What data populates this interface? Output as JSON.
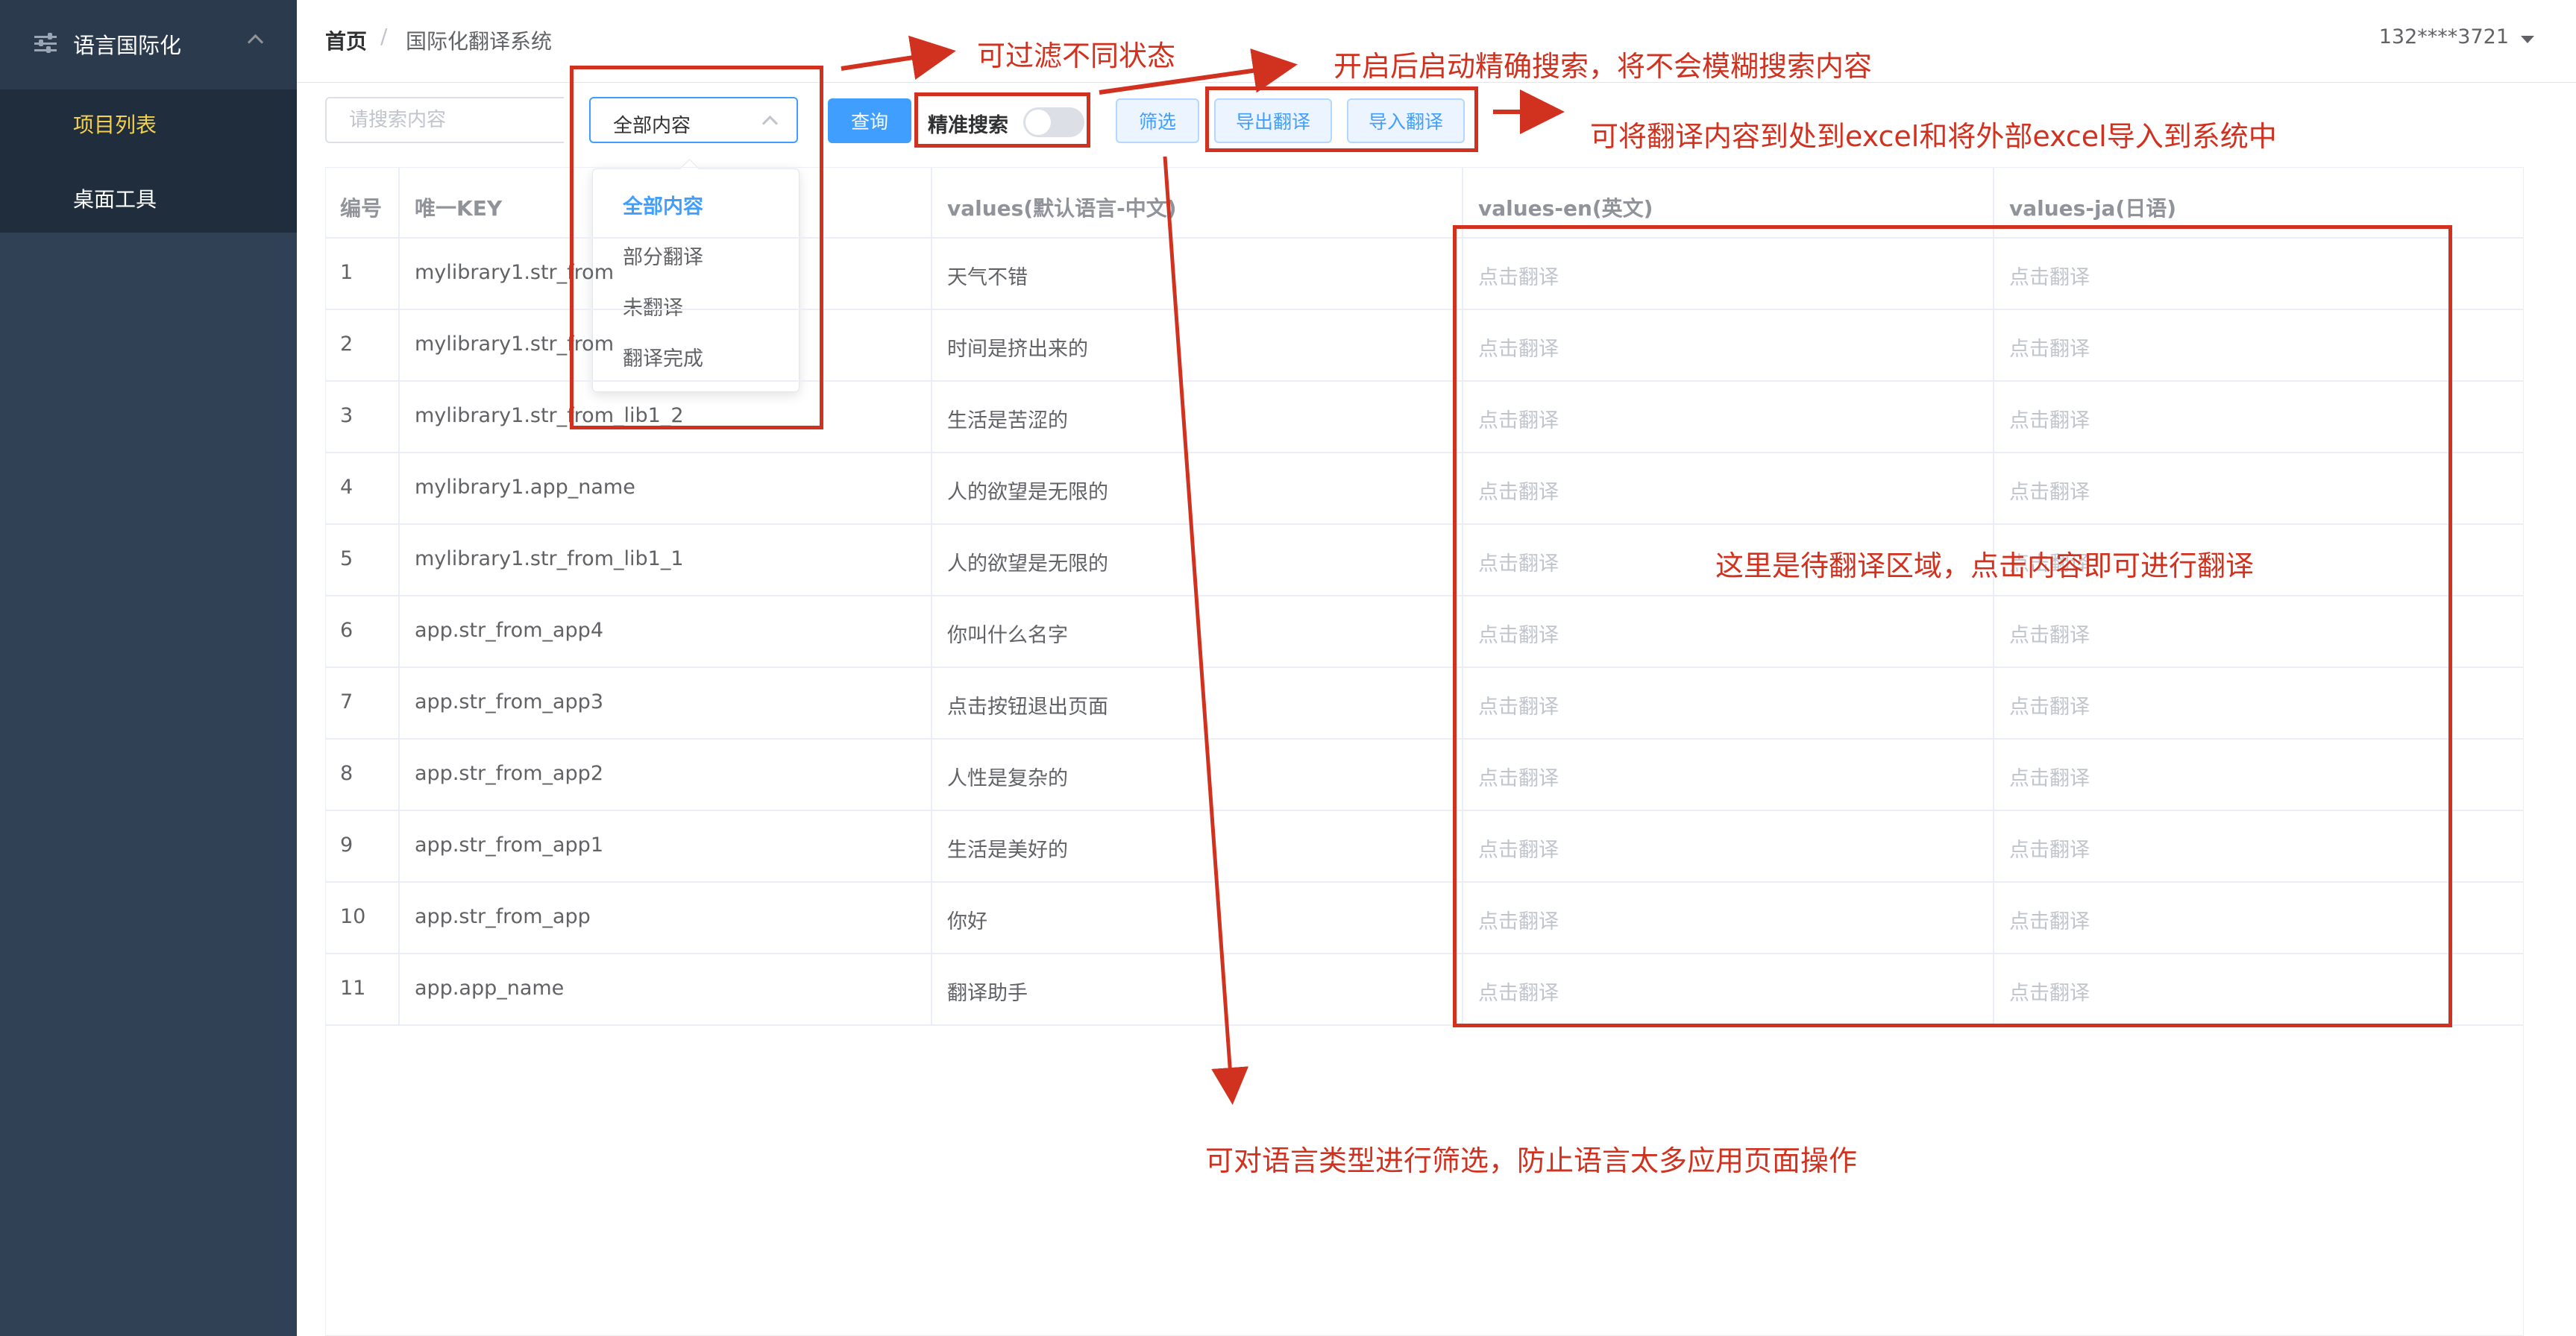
{
  "sidebar": {
    "group_title": "语言国际化",
    "items": [
      {
        "label": "项目列表",
        "active": true
      },
      {
        "label": "桌面工具",
        "active": false
      }
    ]
  },
  "header": {
    "breadcrumb_home": "首页",
    "breadcrumb_separator": "/",
    "breadcrumb_current": "国际化翻译系统",
    "user": "132****3721"
  },
  "toolbar": {
    "search_placeholder": "请搜索内容",
    "select_value": "全部内容",
    "select_options": [
      "全部内容",
      "部分翻译",
      "未翻译",
      "翻译完成"
    ],
    "query_label": "查询",
    "exact_search_label": "精准搜索",
    "exact_search_on": false,
    "filter_label": "筛选",
    "export_label": "导出翻译",
    "import_label": "导入翻译"
  },
  "table": {
    "columns": [
      "编号",
      "唯一KEY",
      "values(默认语言-中文)",
      "values-en(英文)",
      "values-ja(日语)"
    ],
    "placeholder": "点击翻译",
    "rows": [
      {
        "no": "1",
        "key": "mylibrary1.str_from",
        "zh": "天气不错"
      },
      {
        "no": "2",
        "key": "mylibrary1.str_from",
        "zh": "时间是挤出来的"
      },
      {
        "no": "3",
        "key": "mylibrary1.str_from_lib1_2",
        "zh": "生活是苦涩的"
      },
      {
        "no": "4",
        "key": "mylibrary1.app_name",
        "zh": "人的欲望是无限的"
      },
      {
        "no": "5",
        "key": "mylibrary1.str_from_lib1_1",
        "zh": "人的欲望是无限的"
      },
      {
        "no": "6",
        "key": "app.str_from_app4",
        "zh": "你叫什么名字"
      },
      {
        "no": "7",
        "key": "app.str_from_app3",
        "zh": "点击按钮退出页面"
      },
      {
        "no": "8",
        "key": "app.str_from_app2",
        "zh": "人性是复杂的"
      },
      {
        "no": "9",
        "key": "app.str_from_app1",
        "zh": "生活是美好的"
      },
      {
        "no": "10",
        "key": "app.str_from_app",
        "zh": "你好"
      },
      {
        "no": "11",
        "key": "app.app_name",
        "zh": "翻译助手"
      }
    ]
  },
  "annotations": {
    "color": "#d0321f",
    "filter_states": "可过滤不同状态",
    "exact_search": "开启后启动精确搜索，将不会模糊搜索内容",
    "import_export": "可将翻译内容到处到excel和将外部excel导入到系统中",
    "translate_area": "这里是待翻译区域，点击内容即可进行翻译",
    "language_filter": "可对语言类型进行筛选，防止语言太多应用页面操作"
  },
  "colors": {
    "sidebar_bg": "#304156",
    "sidebar_active": "#f4d04b",
    "primary": "#409eff"
  }
}
